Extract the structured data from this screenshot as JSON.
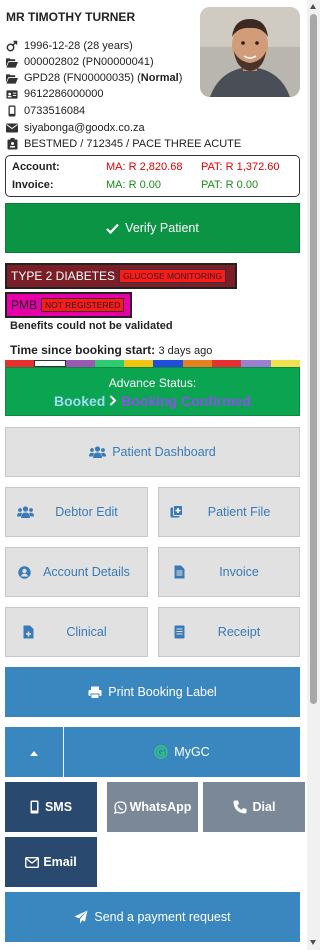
{
  "patient": {
    "name": "MR TIMOTHY TURNER",
    "dob": "1996-12-28 (28 years)",
    "file_no": "000002802 (PN00000041)",
    "gpd": "GPD28 (FN00000035) (",
    "gpd_status": "Normal",
    "gpd_close": ")",
    "id_number": "9612286000000",
    "phone": "0733516084",
    "email": "siyabonga@goodx.co.za",
    "medical_aid": "BESTMED / 712345 / PACE THREE ACUTE"
  },
  "finance": {
    "account_label": "Account:",
    "account_ma": "MA: R 2,820.68",
    "account_pat": "PAT: R 1,372.60",
    "invoice_label": "Invoice:",
    "invoice_ma": "MA: R 0.00",
    "invoice_pat": "PAT: R 0.00"
  },
  "verify_button": "Verify Patient",
  "conditions": {
    "diabetes_label": "TYPE 2 DIABETES",
    "diabetes_tag": "GLUCOSE MONITORING",
    "pmb_label": "PMB",
    "pmb_tag": "NOT REGISTERED"
  },
  "benefits_text": "Benefits could not be validated",
  "booking_time": {
    "label": "Time since booking start:",
    "value": "3 days ago"
  },
  "status": {
    "heading": "Advance Status:",
    "from": "Booked",
    "to": "Booking Confirmed"
  },
  "buttons": {
    "dashboard": "Patient Dashboard",
    "debtor_edit": "Debtor Edit",
    "patient_file": "Patient File",
    "account_details": "Account Details",
    "invoice": "Invoice",
    "clinical": "Clinical",
    "receipt": "Receipt",
    "print_label": "Print Booking Label",
    "mygc": "MyGC",
    "sms": "SMS",
    "whatsapp": "WhatsApp",
    "dial": "Dial",
    "email": "Email",
    "payment_request": "Send a payment request"
  },
  "colors": {
    "verify_green": "#0b9444",
    "status_green": "#0ba451",
    "action_blue": "#3a87c0",
    "navy": "#294a6e",
    "slate": "#7a8898",
    "diabetes_bg": "#7a1f27",
    "pmb_bg": "#e600a8",
    "alert_red": "#ff1a1a"
  },
  "colorbar": [
    "#e83030",
    "#e83030",
    "#ffffff",
    "#9b59b6",
    "#2ecc71",
    "#f1c40f",
    "#1f4fd8",
    "#e67e22",
    "#e83030",
    "#9b7fd0",
    "#f1e04f"
  ]
}
